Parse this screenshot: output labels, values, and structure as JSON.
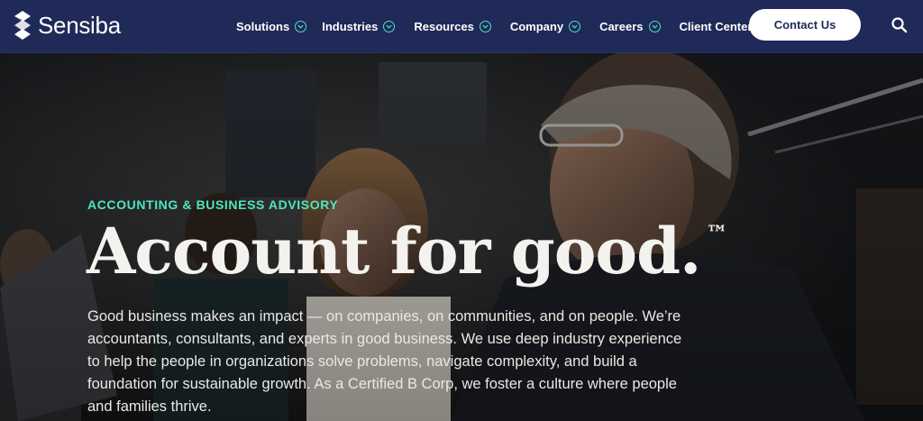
{
  "brand": {
    "name": "Sensiba",
    "logo_icon": "sensiba-mark-icon"
  },
  "nav": {
    "items": [
      {
        "label": "Solutions",
        "has_dropdown": true
      },
      {
        "label": "Industries",
        "has_dropdown": true
      },
      {
        "label": "Resources",
        "has_dropdown": true
      },
      {
        "label": "Company",
        "has_dropdown": true
      },
      {
        "label": "Careers",
        "has_dropdown": true
      },
      {
        "label": "Client Center",
        "has_dropdown": false
      }
    ],
    "contact_label": "Contact Us",
    "search_icon": "search-icon"
  },
  "hero": {
    "eyebrow": "ACCOUNTING & BUSINESS ADVISORY",
    "headline": "Account for good.",
    "trademark": "™",
    "body": "Good business makes an impact — on companies, on communities, and on people. We’re accountants, consultants, and experts in good business. We use deep industry experience to help the people in organizations solve problems, navigate complexity, and build a foundation for sustainable growth. As a Certified B Corp, we foster a culture where people and families thrive."
  },
  "colors": {
    "nav_bg": "#1f2a58",
    "accent": "#4ee0bf",
    "button_bg": "#ffffff",
    "button_text": "#1f2a58"
  }
}
